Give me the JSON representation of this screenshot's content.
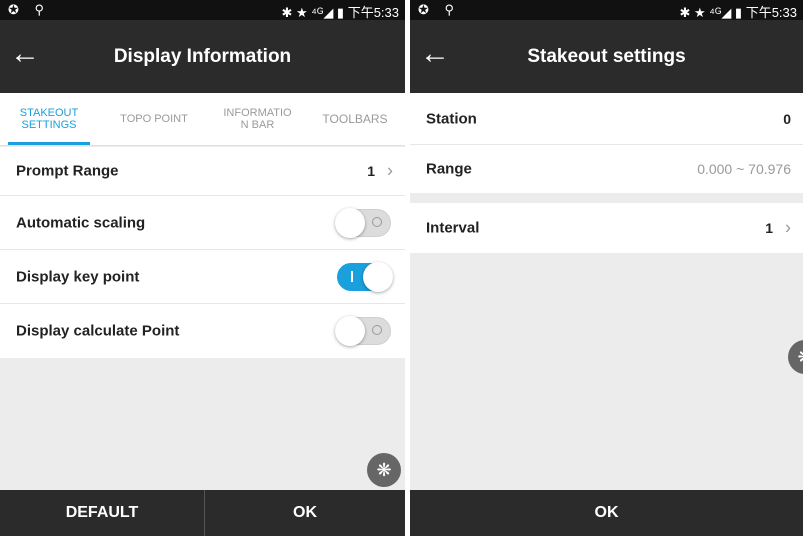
{
  "left": {
    "status": {
      "left_icons": "✪ ⚲",
      "right_text": "✱ ★ ⁴ᴳ◢ ▮ 下午5:33"
    },
    "appbar": {
      "back_icon": "back-arrow-icon",
      "title": "Display Information"
    },
    "tabs": [
      {
        "label": "STAKEOUT\nSETTINGS",
        "active": true
      },
      {
        "label": "TOPO POINT",
        "active": false
      },
      {
        "label": "INFORMATIO\nN BAR",
        "active": false
      },
      {
        "label": "TOOLBARS",
        "active": false
      }
    ],
    "rows": {
      "prompt_range": {
        "label": "Prompt Range",
        "value": "1"
      },
      "automatic_scaling": {
        "label": "Automatic scaling",
        "on": false
      },
      "display_key_point": {
        "label": "Display key point",
        "on": true
      },
      "display_calculate_point": {
        "label": "Display calculate Point",
        "on": false
      }
    },
    "bottom": {
      "default_label": "DEFAULT",
      "ok_label": "OK"
    }
  },
  "right": {
    "status": {
      "left_icons": "✪ ⚲",
      "right_text": "✱ ★ ⁴ᴳ◢ ▮ 下午5:33"
    },
    "appbar": {
      "back_icon": "back-arrow-icon",
      "title": "Stakeout settings"
    },
    "rows": {
      "station": {
        "label": "Station",
        "value": "0"
      },
      "range": {
        "label": "Range",
        "value": "0.000 ~ 70.976"
      },
      "interval": {
        "label": "Interval",
        "value": "1"
      }
    },
    "bottom": {
      "ok_label": "OK"
    }
  },
  "colors": {
    "accent": "#1aa0dc",
    "bar": "#2b2b2b",
    "background": "#ececec"
  }
}
